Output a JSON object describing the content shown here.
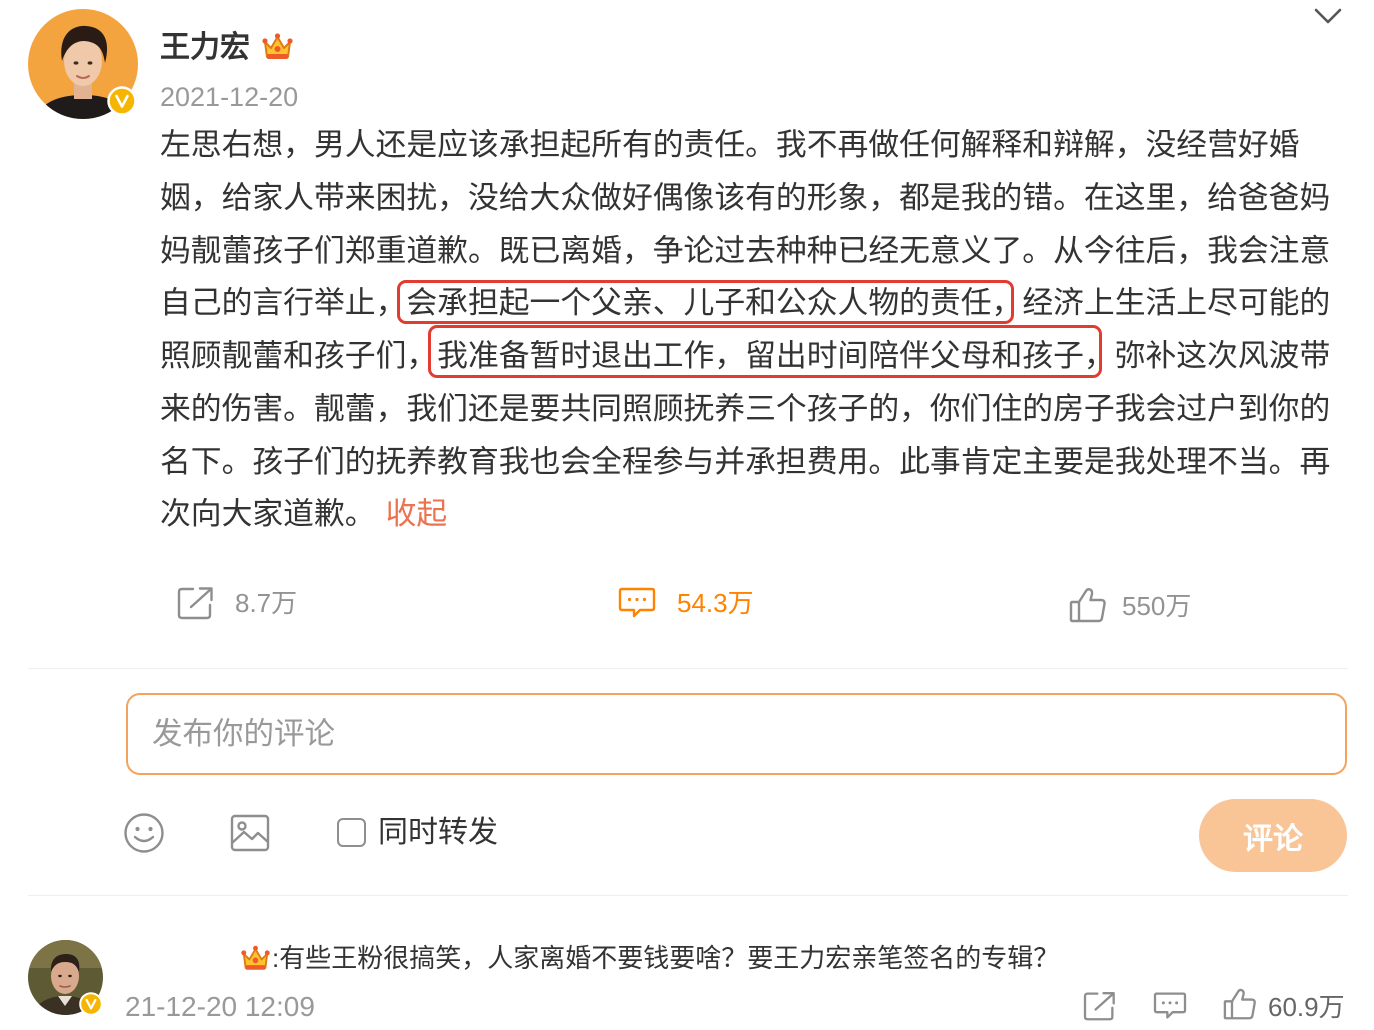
{
  "author": {
    "name": "王力宏",
    "date": "2021-12-20",
    "verified": true
  },
  "post": {
    "lines": [
      [
        "左思右想，男人还是应该承担起所有的责任。我不再做任何解释和辩解，没经营好婚"
      ],
      [
        "姻，给家人带来困扰，没给大众做好偶像该有的形象，都是我的错。在这里，给爸爸妈"
      ],
      [
        "妈靓蕾孩子们郑重道歉。既已离婚，争论过去种种已经无意义了。从今往后，我会注意"
      ],
      [
        "自己的言行举止，",
        "会承担起一个父亲、儿子和公众人物的责任，",
        "经济上生活上尽可能的"
      ],
      [
        "照顾靓蕾和孩子们，",
        "我准备暂时退出工作，留出时间陪伴父母和孩子，",
        "弥补这次风波带"
      ],
      [
        "来的伤害。靓蕾，我们还是要共同照顾抚养三个孩子的，你们住的房子我会过户到你的"
      ],
      [
        "名下。孩子们的抚养教育我也会全程参与并承担费用。此事肯定主要是我处理不当。再"
      ],
      [
        "次向大家道歉。"
      ]
    ],
    "collapse_label": "收起"
  },
  "actions": {
    "share_count": "8.7万",
    "comment_count": "54.3万",
    "like_count": "550万"
  },
  "composer": {
    "placeholder": "发布你的评论",
    "repost_label": "同时转发",
    "repost_checked": false,
    "submit_label": "评论"
  },
  "comments": [
    {
      "text": ":有些王粉很搞笑，人家离婚不要钱要啥？要王力宏亲笔签名的专辑？",
      "time": "21-12-20 12:09",
      "like_count": "60.9万",
      "verified": true
    }
  ],
  "icons": {
    "collapse": "chevron-down-icon",
    "badge": "crown-icon",
    "verified": "verified-badge-icon",
    "share": "share-icon",
    "comment": "comment-icon",
    "like": "thumbs-up-icon",
    "emoji": "emoji-icon",
    "image": "image-icon"
  },
  "colors": {
    "accent": "#ff8200",
    "collapse_link": "#eb7350",
    "highlight_box": "#e23b2f",
    "input_border": "#f2a35e",
    "submit_disabled": "#f9c597",
    "text": "#333333",
    "muted": "#939393"
  }
}
